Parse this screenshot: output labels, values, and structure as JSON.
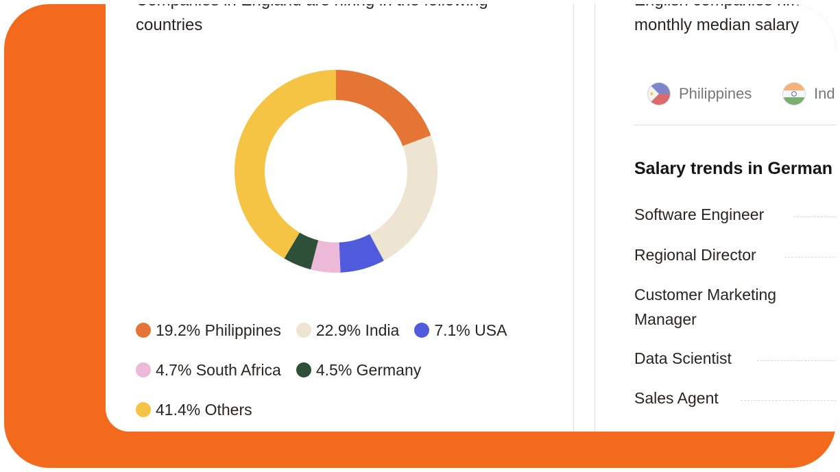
{
  "left_panel": {
    "heading": "Companies in England are hiring in the following countries"
  },
  "right_panel": {
    "heading": "English companies hi… monthly median salary",
    "country_tabs": [
      {
        "label": "Philippines",
        "flag_icon": "philippines-flag-icon"
      },
      {
        "label": "India",
        "flag_icon": "india-flag-icon"
      }
    ],
    "section_title": "Salary trends in German",
    "jobs": [
      {
        "name": "Software Engineer"
      },
      {
        "name": "Regional Director"
      },
      {
        "name": "Customer Marketing Manager"
      },
      {
        "name": "Data Scientist"
      },
      {
        "name": "Sales Agent"
      }
    ]
  },
  "colors": {
    "frame_orange": "#f46a1d",
    "philippines": "#e57535",
    "india": "#ede4d2",
    "usa": "#4f5bdc",
    "south_africa": "#edb9d8",
    "germany": "#2e5039",
    "others": "#f5c445"
  },
  "chart_data": {
    "type": "pie",
    "title": "",
    "donut": true,
    "start": "top",
    "slices": [
      {
        "label": "Philippines",
        "value": 19.2,
        "legend": "19.2% Philippines",
        "color": "#e57535"
      },
      {
        "label": "India",
        "value": 22.9,
        "legend": "22.9% India",
        "color": "#ede4d2"
      },
      {
        "label": "USA",
        "value": 7.1,
        "legend": "7.1% USA",
        "color": "#4f5bdc"
      },
      {
        "label": "South Africa",
        "value": 4.7,
        "legend": "4.7% South Africa",
        "color": "#edb9d8"
      },
      {
        "label": "Germany",
        "value": 4.5,
        "legend": "4.5% Germany",
        "color": "#2e5039"
      },
      {
        "label": "Others",
        "value": 41.4,
        "legend": "41.4% Others",
        "color": "#f5c445"
      }
    ],
    "legend_rows": [
      [
        0,
        1,
        2
      ],
      [
        3,
        4
      ],
      [
        5
      ]
    ],
    "legend_position": "bottom"
  }
}
